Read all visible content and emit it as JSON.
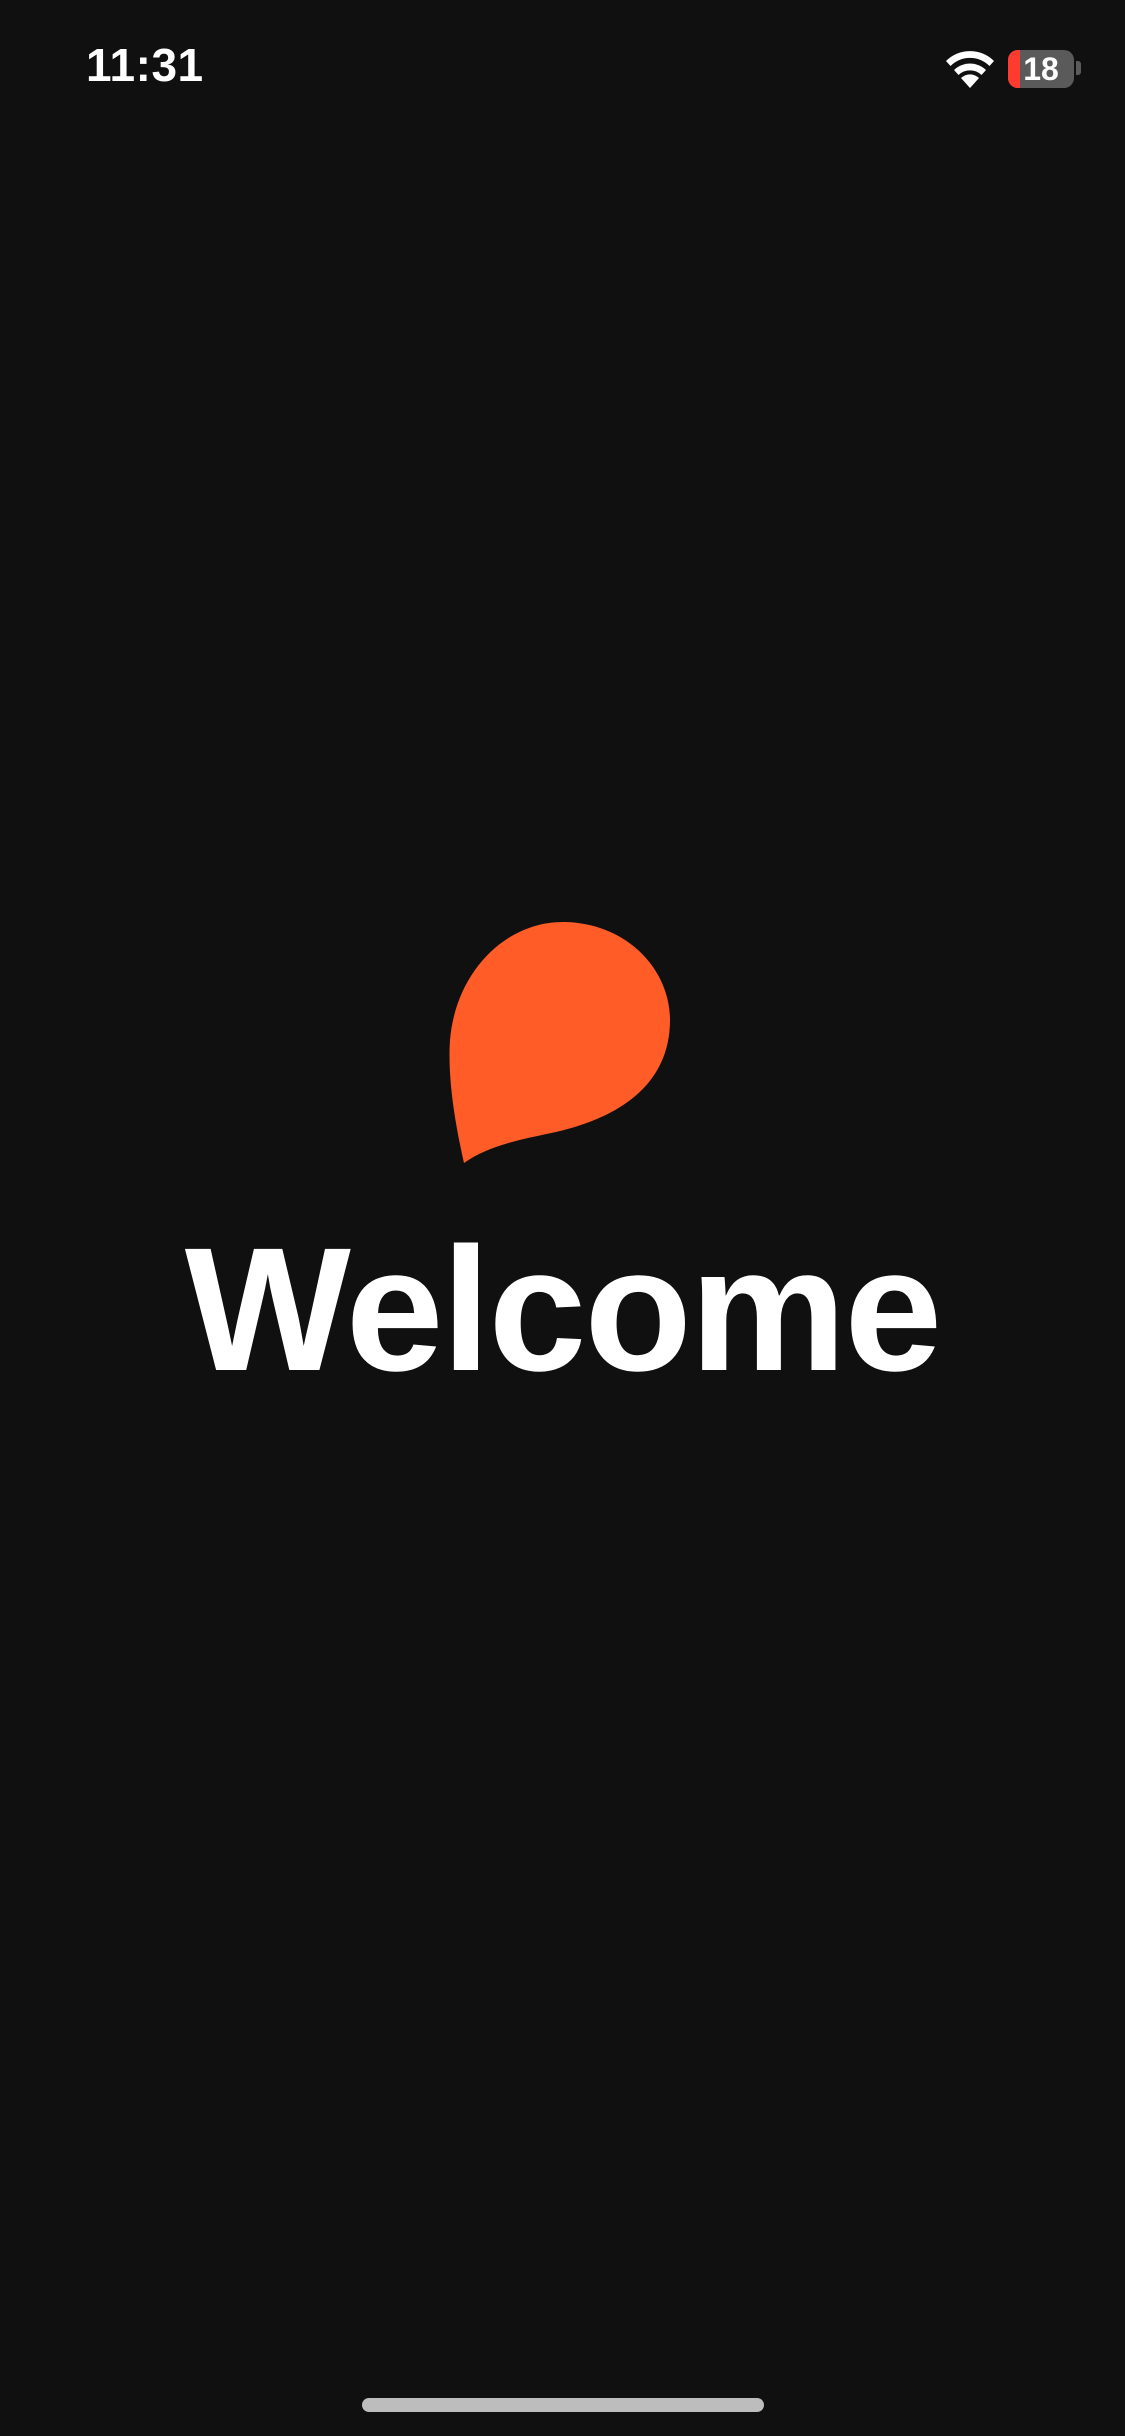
{
  "status_bar": {
    "time": "11:31",
    "battery_level": "18",
    "battery_fraction": 0.18,
    "battery_color": "#ff3b30",
    "wifi_icon": "wifi-icon"
  },
  "brand": {
    "logo_icon": "drop-logo-icon",
    "logo_color": "#ff5c28"
  },
  "main": {
    "welcome_text": "Welcome"
  },
  "colors": {
    "background": "#101010",
    "text": "#ffffff"
  }
}
